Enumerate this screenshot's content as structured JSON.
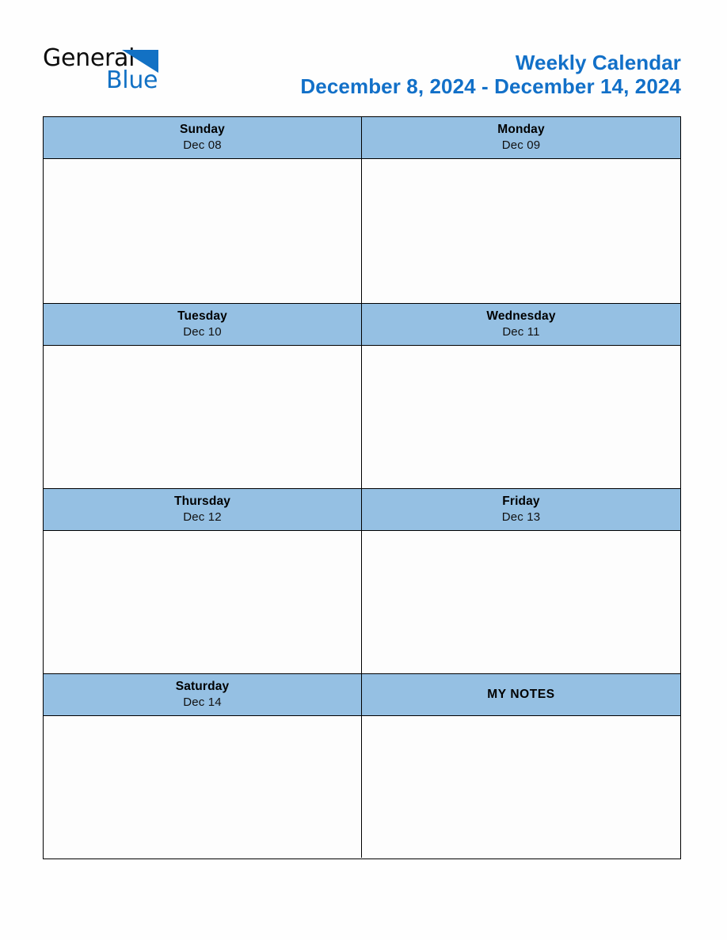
{
  "brand": {
    "name_part1": "General",
    "name_part2": "Blue",
    "triangle_color": "#1271c4",
    "text_color": "#0d0d0d"
  },
  "header": {
    "title": "Weekly Calendar",
    "date_range": "December 8, 2024 - December 14, 2024",
    "title_color": "#1270c8"
  },
  "colors": {
    "header_cell_background": "#95c0e3",
    "cell_background": "#fdfdfd",
    "border": "#000000",
    "page_background": "#fefefe"
  },
  "calendar": {
    "blocks": [
      {
        "left": {
          "day": "Sunday",
          "date": "Dec 08",
          "content": ""
        },
        "right": {
          "day": "Monday",
          "date": "Dec 09",
          "content": ""
        }
      },
      {
        "left": {
          "day": "Tuesday",
          "date": "Dec 10",
          "content": ""
        },
        "right": {
          "day": "Wednesday",
          "date": "Dec 11",
          "content": ""
        }
      },
      {
        "left": {
          "day": "Thursday",
          "date": "Dec 12",
          "content": ""
        },
        "right": {
          "day": "Friday",
          "date": "Dec 13",
          "content": ""
        }
      },
      {
        "left": {
          "day": "Saturday",
          "date": "Dec 14",
          "content": ""
        },
        "right": {
          "day": "MY NOTES",
          "date": "",
          "content": ""
        }
      }
    ]
  }
}
